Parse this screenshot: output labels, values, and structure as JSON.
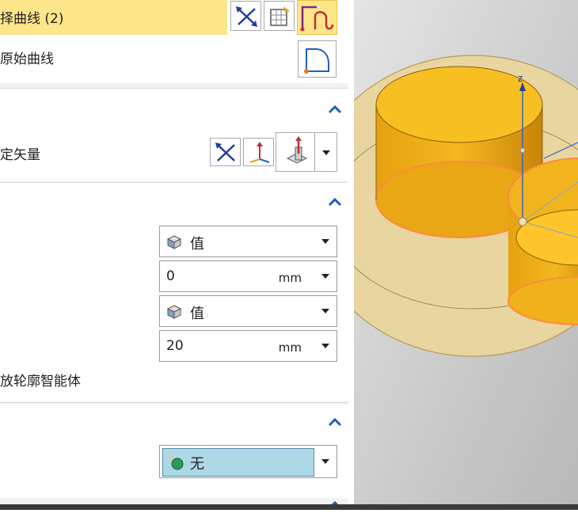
{
  "select_curve": {
    "label": "择曲线 (2)"
  },
  "original_curve": {
    "label": "原始曲线"
  },
  "vector": {
    "label": "定矢量"
  },
  "limits": {
    "start_type": "值",
    "start_value": "0",
    "start_unit": "mm",
    "end_type": "值",
    "end_value": "20",
    "end_unit": "mm",
    "smart_body_label": "放轮廓智能体"
  },
  "boolean": {
    "value": "无"
  },
  "colors": {
    "selected_row": "#fde58a",
    "accent_blue": "#1f5fbf",
    "boolean_fill": "#add8e6",
    "cylinder": "#f5b81e"
  }
}
